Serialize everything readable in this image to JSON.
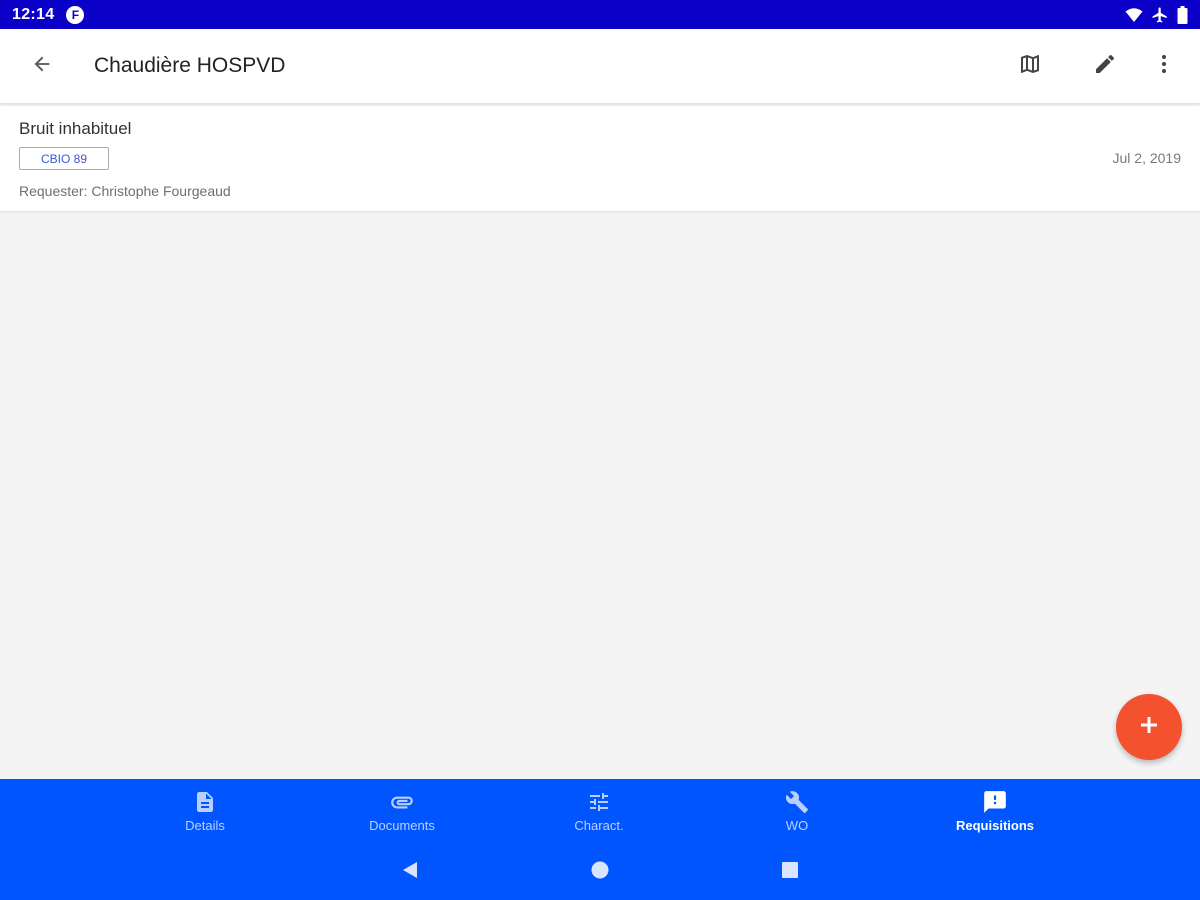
{
  "status_bar": {
    "time": "12:14",
    "app_icon_letter": "F",
    "icons": [
      "wifi-icon",
      "airplane-icon",
      "battery-icon"
    ]
  },
  "app_bar": {
    "title": "Chaudière HOSPVD",
    "back_icon": "arrow-back-icon",
    "actions": [
      "map-icon",
      "edit-icon",
      "more-vert-icon"
    ]
  },
  "requisition": {
    "title": "Bruit inhabituel",
    "tag": "CBIO 89",
    "date": "Jul 2, 2019",
    "requester": "Requester: Christophe Fourgeaud"
  },
  "fab": {
    "icon": "plus-icon"
  },
  "bottom_nav": {
    "tabs": [
      {
        "label": "Details",
        "icon": "document-icon",
        "active": false
      },
      {
        "label": "Documents",
        "icon": "paperclip-icon",
        "active": false
      },
      {
        "label": "Charact.",
        "icon": "tune-icon",
        "active": false
      },
      {
        "label": "WO",
        "icon": "wrench-icon",
        "active": false
      },
      {
        "label": "Requisitions",
        "icon": "feedback-icon",
        "active": true
      }
    ],
    "active_tab": "Requisitions"
  },
  "system_nav": [
    "back-triangle-icon",
    "home-circle-icon",
    "recents-square-icon"
  ],
  "colors": {
    "status_bar": "#0a00c8",
    "bottom_nav": "#0055fe",
    "fab": "#f4522e",
    "chip_text": "#3a58d6",
    "background": "#f4f4f4"
  }
}
